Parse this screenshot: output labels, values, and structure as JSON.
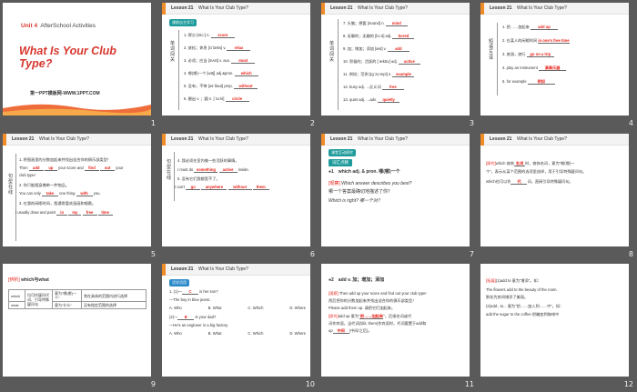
{
  "common": {
    "lesson": "Lesson 21",
    "subtitle": "What Is Your Club Type?"
  },
  "slide1": {
    "unit": "Unit 4",
    "unit_title": "AfterSchool Activities",
    "title": "What Is Your Club Type?",
    "footer": "第一PPT模板网-WWW.1PPT.COM",
    "number": "1"
  },
  "slide2": {
    "badge": "课前自主学习",
    "side": [
      "单",
      "词",
      "闯",
      "关"
    ],
    "lines": [
      {
        "n": "1.",
        "t": "得分 [skɔː] n. ",
        "a": "score"
      },
      {
        "n": "2.",
        "t": "放松；休息 [rɪˈlæks] v. ",
        "a": "relax"
      },
      {
        "n": "3.",
        "t": "必须；应当 [mʌst] v. aux. ",
        "a": "must"
      },
      {
        "n": "4.",
        "t": "哪(哪)一个 [wɪtʃ] adj.&pron. ",
        "a": "which"
      },
      {
        "n": "5.",
        "t": "没有；不带 [wɪˈðaʊt] prep. ",
        "a": "without"
      },
      {
        "n": "6.",
        "t": "圈出 v. ；圆 n. [ˈsɜːkl] ",
        "a": "circle"
      }
    ],
    "number": "2"
  },
  "slide3": {
    "side": [
      "单",
      "词",
      "闯",
      "关"
    ],
    "lines": [
      {
        "n": "7.",
        "t": "头脑；想要 [maɪnd] n. ",
        "a": "mind"
      },
      {
        "n": "8.",
        "t": "无聊的；无趣的 [bɔːd] adj. ",
        "a": "bored"
      },
      {
        "n": "9.",
        "t": "加；增加；添加 [æd] v. ",
        "a": "add"
      },
      {
        "n": "10.",
        "t": "积极的；活跃的 [ˈæktɪv] adj. ",
        "a": "active"
      },
      {
        "n": "11.",
        "t": "例如；范例 [ɪɡˈzɑːmpl] n. ",
        "a": "example"
      },
      {
        "n": "12.",
        "t": "busy adj. →反义词 ",
        "a": "free"
      },
      {
        "n": "13.",
        "t": "quiet adj. →adv. ",
        "a": "quietly"
      }
    ],
    "number": "3"
  },
  "slide4": {
    "side": [
      "短",
      "语",
      "互",
      "译"
    ],
    "lines": [
      {
        "n": "1.",
        "t": "把……加起来 ",
        "a": "add up"
      },
      {
        "n": "2.",
        "t": "在某人的闲暇时间 ",
        "a": "in one's free time"
      },
      {
        "n": "3.",
        "t": "旅游，旅行 ",
        "a": "go on a trip"
      },
      {
        "n": "4.",
        "t": "play an instrument ",
        "a": "演奏乐器"
      },
      {
        "n": "5.",
        "t": "for example ",
        "a": "例如"
      }
    ],
    "number": "4"
  },
  "slide5": {
    "side": [
      "句",
      "型",
      "在",
      "线"
    ],
    "l1": "1. 将图画里的分数加起来并找出适合你的俱乐部类型！",
    "l2a": "Then ",
    "l2b": " your score and ",
    "l2c": " your",
    "a_add": "add",
    "a_up": "up",
    "a_find": "find",
    "a_out": "out",
    "l3": "club type!",
    "l4": "2. 你只能随身携带一件物品。",
    "l5a": "You can only ",
    "l5b": " one thing ",
    "l5c": " you.",
    "a_take": "take",
    "a_with": "with",
    "l6": "3. 在我的闲暇时间，我通常喜欢画画和唱歌。",
    "l7a": "I usually draw and paint ",
    "a_in": "in",
    "a_my": "my",
    "a_free": "free",
    "a_time": "time",
    "number": "5"
  },
  "slide6": {
    "side": [
      "句",
      "型",
      "在",
      "线"
    ],
    "l1": "4. 我必须在室内做一些活跃的事情。",
    "l2a": "I must do ",
    "a_something": "something",
    "a_active": "active",
    "l2b": " inside.",
    "l3": "5. 没有它们我都受不了。",
    "l4a": "I can't ",
    "a_go": "go",
    "a_anywhere": "anywhere",
    "a_without": "without",
    "a_them": "them",
    "number": "6"
  },
  "slide7": {
    "badge": "课堂互动探究",
    "section": "词汇点睛",
    "point": "●1　which adj. & pron. 哪(哪)一个",
    "tag": "[观察]",
    "q1": "Which answer describes you best?",
    "q1cn": "哪一个答案最确切地描述了你？",
    "q2": "Which is right?  哪一个对？",
    "number": "7"
  },
  "slide8": {
    "tag": "[探究]",
    "l1a": "which 修饰",
    "a_noun": "名词",
    "l1b": "时，修饰名词，意为“哪(哪)一",
    "l2": "个”，表示从某个范围的选项里选择，用于引导特殊疑问句。",
    "l3a": "which也可以作",
    "a_dai": "代",
    "l3b": "词，直接引导特殊疑问句。",
    "number": "8"
  },
  "slide9": {
    "tag": "[辨析]",
    "title": "which与what",
    "r1c1": "which",
    "r1c2": "均可作疑问代词、引导特殊疑问句",
    "r1c3": "意为“哪(哪)一个”",
    "r1c4": "常在具体的范围内进行选择",
    "r2c1": "what",
    "r2c3": "意为“什么”",
    "r2c4": "没有指定范围的选择",
    "number": "9"
  },
  "slide10": {
    "badge": "活学活用",
    "q1a": "1. (1)—",
    "q1ans": "C",
    "q1b": " is her son?",
    "q1c": "—The boy in blue jeans.",
    "opts1": [
      "A. Who",
      "B. What",
      "C. Which",
      "D. Where"
    ],
    "q2a": "(2)—",
    "q2ans": "B",
    "q2b": " is your dad?",
    "q2c": "—He's an engineer in a big factory.",
    "opts2": [
      "A. Who",
      "B. What",
      "C. Which",
      "D. Where"
    ],
    "number": "10"
  },
  "slide11": {
    "point": "●2　add v. 加；增加；添加",
    "tag": "[观察]",
    "l1": "Then add up your score and find out your club type!",
    "l2": "然后把你的分数加起来并找出适合你的俱乐部类型！",
    "l3": "Please add them up. 请把它们加起来。",
    "tag2": "[探究]",
    "l4a": "add up 意为“",
    "a_jia": "把……加起来",
    "l4b": "”，后接名词或代",
    "l5": "词作宾语，当代词(如it, them)作宾语时，代词要置于add和",
    "l6a": "up",
    "a_mid": "中间",
    "l6b": "(中间/之后)。",
    "number": "11"
  },
  "slide12": {
    "tag": "[拓展]",
    "l1a": "(1)add to 意为“增添”。如：",
    "l2": "The flowers add to the beauty of the room.",
    "l3": "鲜花为房间增添了美丽。",
    "l4": "(2)add...to... 意为“把……加入到……中”。如：",
    "l5": "add the sugar to the coffee  把糖加到咖啡中",
    "number": "12"
  }
}
